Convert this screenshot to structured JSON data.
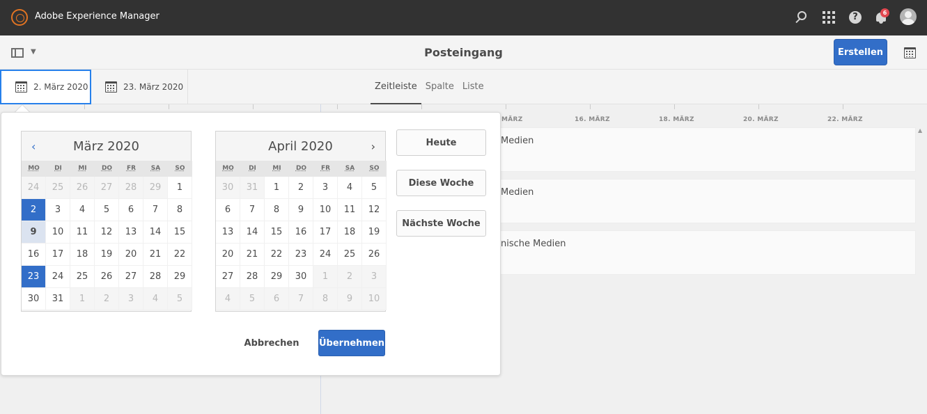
{
  "shell": {
    "app_title": "Adobe Experience Manager",
    "notification_count": "6"
  },
  "actionbar": {
    "page_title": "Posteingang",
    "create_label": "Erstellen"
  },
  "range": {
    "start": "2. März 2020",
    "end": "23. März 2020"
  },
  "views": [
    "Zeitleiste",
    "Spalte",
    "Liste"
  ],
  "timeline": {
    "axis_labels": [
      "MÄRZ",
      "16. MÄRZ",
      "18. MÄRZ",
      "20. MÄRZ",
      "22. MÄRZ"
    ],
    "rows": [
      "Medien",
      "Medien",
      "nische Medien"
    ]
  },
  "datepicker": {
    "weekdays": [
      "MO",
      "DI",
      "MI",
      "DO",
      "FR",
      "SA",
      "SO"
    ],
    "left": {
      "title": "März 2020",
      "days": [
        [
          24,
          25,
          26,
          27,
          28,
          29,
          1
        ],
        [
          2,
          3,
          4,
          5,
          6,
          7,
          8
        ],
        [
          9,
          10,
          11,
          12,
          13,
          14,
          15
        ],
        [
          16,
          17,
          18,
          19,
          20,
          21,
          22
        ],
        [
          23,
          24,
          25,
          26,
          27,
          28,
          29
        ],
        [
          30,
          31,
          1,
          2,
          3,
          4,
          5
        ]
      ]
    },
    "right": {
      "title": "April 2020",
      "days": [
        [
          30,
          31,
          1,
          2,
          3,
          4,
          5
        ],
        [
          6,
          7,
          8,
          9,
          10,
          11,
          12
        ],
        [
          13,
          14,
          15,
          16,
          17,
          18,
          19
        ],
        [
          20,
          21,
          22,
          23,
          24,
          25,
          26
        ],
        [
          27,
          28,
          29,
          30,
          1,
          2,
          3
        ],
        [
          4,
          5,
          6,
          7,
          8,
          9,
          10
        ]
      ]
    },
    "quick": [
      "Heute",
      "Diese Woche",
      "Nächste Woche"
    ],
    "cancel_label": "Abbrechen",
    "apply_label": "Übernehmen"
  },
  "colors": {
    "accent": "#326ec8",
    "shell": "#323232",
    "badge": "#e34850",
    "logo": "#e37422"
  }
}
